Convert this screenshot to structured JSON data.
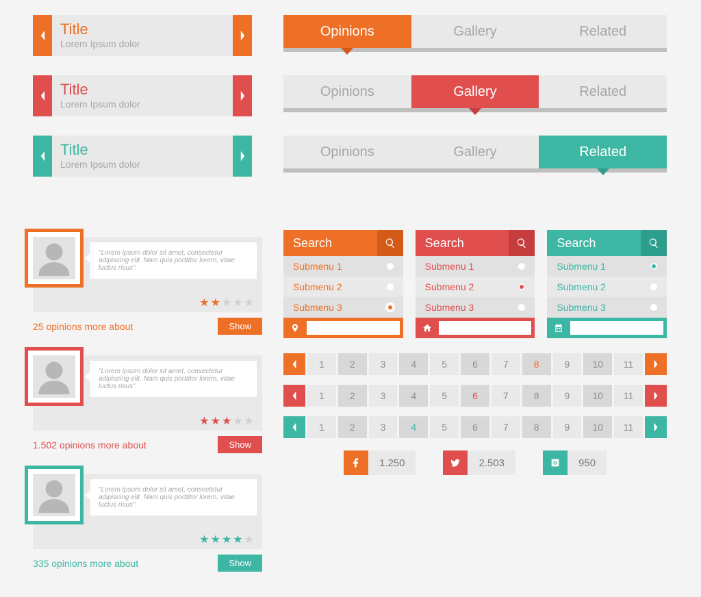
{
  "sliders": [
    {
      "title": "Title",
      "subtitle": "Lorem Ipsum dolor",
      "color": "orange"
    },
    {
      "title": "Title",
      "subtitle": "Lorem Ipsum dolor",
      "color": "red"
    },
    {
      "title": "Title",
      "subtitle": "Lorem Ipsum dolor",
      "color": "teal"
    }
  ],
  "tabbars": [
    {
      "color": "orange",
      "active": 0,
      "tabs": [
        "Opinions",
        "Gallery",
        "Related"
      ]
    },
    {
      "color": "red",
      "active": 1,
      "tabs": [
        "Opinions",
        "Gallery",
        "Related"
      ]
    },
    {
      "color": "teal",
      "active": 2,
      "tabs": [
        "Opinions",
        "Gallery",
        "Related"
      ]
    }
  ],
  "opinions": [
    {
      "color": "orange",
      "quote": "\"Lorem ipsum dolor sit amet, consectetur adipiscing elit. Nam quis porttitor lorem, vitae luctus risus\".",
      "stars": 2,
      "footer": "25 opinions more about",
      "button": "Show"
    },
    {
      "color": "red",
      "quote": "\"Lorem ipsum dolor sit amet, consectetur adipiscing elit. Nam quis porttitor lorem, vitae luctus risus\".",
      "stars": 3,
      "footer": "1.502 opinions more about",
      "button": "Show"
    },
    {
      "color": "teal",
      "quote": "\"Lorem ipsum dolor sit amet, consectetur adipiscing elit. Nam quis porttitor lorem, vitae luctus risus\".",
      "stars": 4,
      "footer": "335 opinions more about",
      "button": "Show"
    }
  ],
  "menus": [
    {
      "color": "orange",
      "title": "Search",
      "items": [
        "Submenu 1",
        "Submenu 2",
        "Submenu 3"
      ],
      "selected": 2,
      "foot_icon": "pin"
    },
    {
      "color": "red",
      "title": "Search",
      "items": [
        "Submenu 1",
        "Submenu 2",
        "Submenu 3"
      ],
      "selected": 1,
      "foot_icon": "home"
    },
    {
      "color": "teal",
      "title": "Search",
      "items": [
        "Submenu 1",
        "Submenu 2",
        "Submenu 3"
      ],
      "selected": 0,
      "foot_icon": "calendar"
    }
  ],
  "paginations": [
    {
      "color": "orange",
      "pages": [
        "1",
        "2",
        "3",
        "4",
        "5",
        "6",
        "7",
        "8",
        "9",
        "10",
        "11"
      ],
      "current": 7
    },
    {
      "color": "red",
      "pages": [
        "1",
        "2",
        "3",
        "4",
        "5",
        "6",
        "7",
        "8",
        "9",
        "10",
        "11"
      ],
      "current": 5
    },
    {
      "color": "teal",
      "pages": [
        "1",
        "2",
        "3",
        "4",
        "5",
        "6",
        "7",
        "8",
        "9",
        "10",
        "11"
      ],
      "current": 3
    }
  ],
  "socials": [
    {
      "icon": "facebook",
      "color": "orange",
      "count": "1.250"
    },
    {
      "icon": "twitter",
      "color": "red",
      "count": "2.503"
    },
    {
      "icon": "instagram",
      "color": "teal",
      "count": "950"
    }
  ],
  "colors": {
    "orange": "#ED7026",
    "red": "#E04E4D",
    "teal": "#3DB6A3"
  }
}
